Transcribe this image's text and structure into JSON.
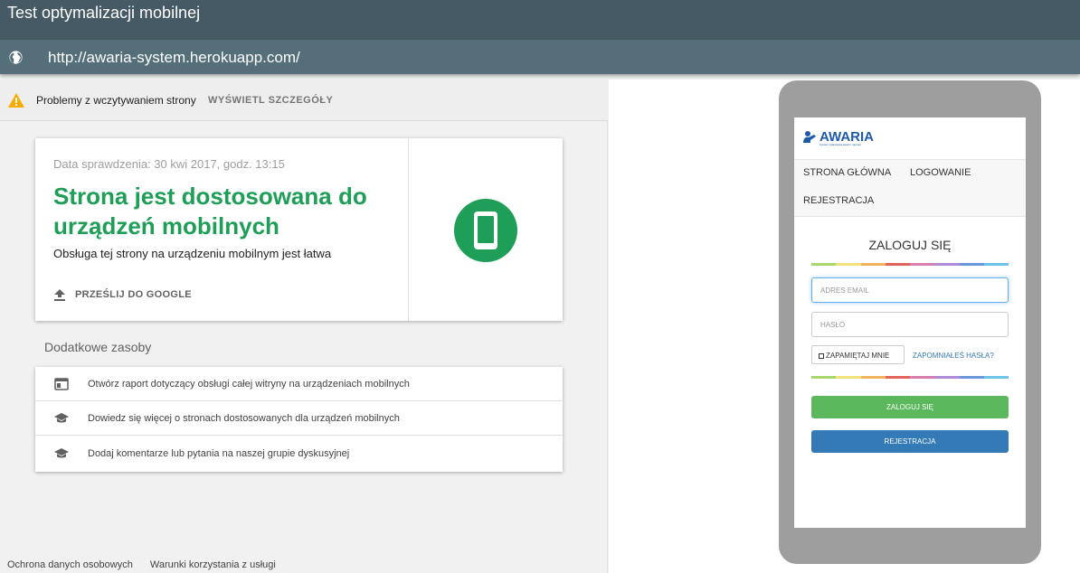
{
  "app": {
    "title": "Test optymalizacji mobilnej",
    "url": "http://awaria-system.herokuapp.com/"
  },
  "warning": {
    "text": "Problemy z wczytywaniem strony",
    "details_label": "WYŚWIETL SZCZEGÓŁY",
    "icon": "warning-icon",
    "color": "#f9ab00"
  },
  "result": {
    "date": "Data sprawdzenia: 30 kwi 2017, godz. 13:15",
    "headline": "Strona jest dostosowana do urządzeń mobilnych",
    "subtitle": "Obsługa tej strony na urządzeniu mobilnym jest łatwa",
    "submit_label": "PRZEŚLIJ DO GOOGLE",
    "accent_color": "#1e9e57"
  },
  "resources": {
    "heading": "Dodatkowe zasoby",
    "items": [
      {
        "icon": "report-icon",
        "label": "Otwórz raport dotyczący obsługi całej witryny na urządzeniach mobilnych"
      },
      {
        "icon": "graduation-cap-icon",
        "label": "Dowiedz się więcej o stronach dostosowanych dla urządzeń mobilnych"
      },
      {
        "icon": "graduation-cap-icon",
        "label": "Dodaj komentarze lub pytania na naszej grupie dyskusyjnej"
      }
    ]
  },
  "footer": {
    "links": [
      "Ochrona danych osobowych",
      "Warunki korzystania z usługi"
    ]
  },
  "preview": {
    "brand": "AWARIA",
    "tagline": "System zgłaszania awarii i napraw",
    "nav": [
      "STRONA GŁÓWNA",
      "LOGOWANIE",
      "REJESTRACJA"
    ],
    "login_title": "ZALOGUJ SIĘ",
    "email_placeholder": "ADRES EMAIL",
    "password_placeholder": "HASŁO",
    "remember_label": "ZAPAMIĘTAJ MNIE",
    "forgot_label": "ZAPOMNIAŁEŚ HASŁA?",
    "login_button": "ZALOGUJ SIĘ",
    "register_button": "REJESTRACJA",
    "rainbow_colors": [
      "#a8d86b",
      "#f3e27a",
      "#f2b55e",
      "#e2635c",
      "#d87fb0",
      "#b08bd9",
      "#6a97d9",
      "#6cc4e8"
    ]
  }
}
